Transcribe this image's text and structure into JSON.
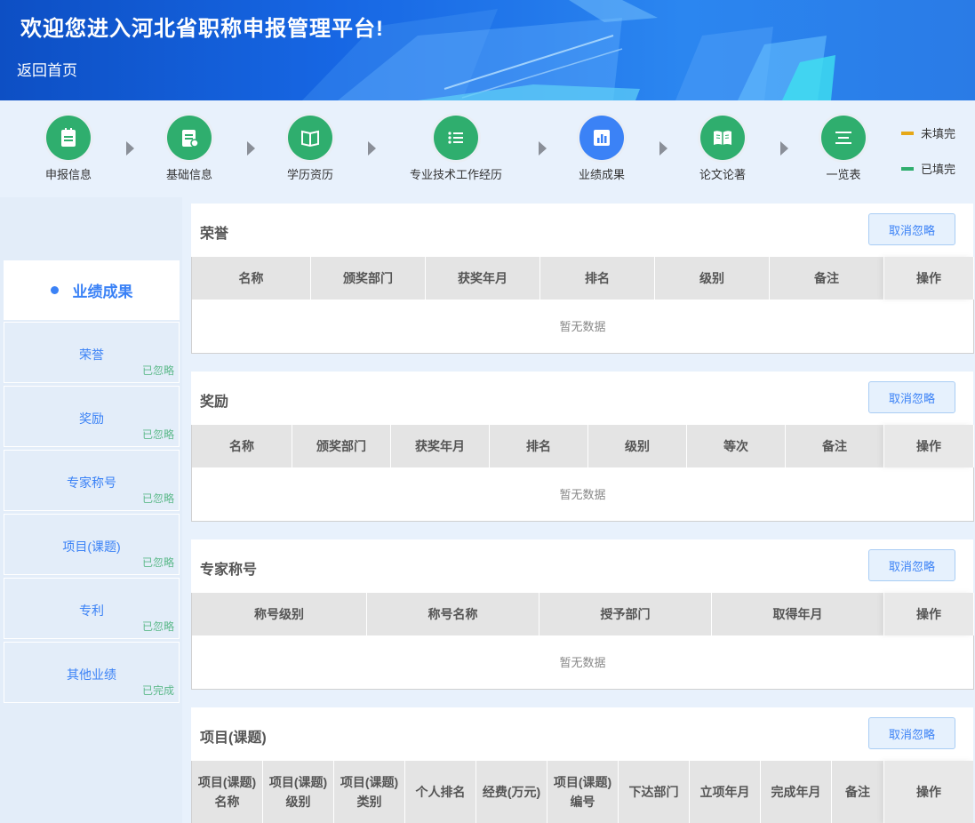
{
  "header": {
    "title": "欢迎您进入河北省职称申报管理平台!",
    "back_label": "返回首页"
  },
  "steps": [
    {
      "label": "申报信息",
      "icon": "clipboard-icon",
      "color": "green"
    },
    {
      "label": "基础信息",
      "icon": "edit-document-icon",
      "color": "green"
    },
    {
      "label": "学历资历",
      "icon": "book-icon",
      "color": "green"
    },
    {
      "label": "专业技术工作经历",
      "icon": "list-icon",
      "color": "green"
    },
    {
      "label": "业绩成果",
      "icon": "bar-chart-icon",
      "color": "blue"
    },
    {
      "label": "论文论著",
      "icon": "open-book-icon",
      "color": "green"
    },
    {
      "label": "一览表",
      "icon": "menu-icon",
      "color": "green"
    }
  ],
  "legend": {
    "incomplete": "未填完",
    "complete": "已填完",
    "incomplete_color": "#e6a817",
    "complete_color": "#2fae6e"
  },
  "sidebar": {
    "header": "业绩成果",
    "items": [
      {
        "name": "荣誉",
        "status": "已忽略"
      },
      {
        "name": "奖励",
        "status": "已忽略"
      },
      {
        "name": "专家称号",
        "status": "已忽略"
      },
      {
        "name": "项目(课题)",
        "status": "已忽略"
      },
      {
        "name": "专利",
        "status": "已忽略"
      },
      {
        "name": "其他业绩",
        "status": "已完成"
      }
    ]
  },
  "sections": {
    "honor": {
      "title": "荣誉",
      "button": "取消忽略",
      "columns": [
        "名称",
        "颁奖部门",
        "获奖年月",
        "排名",
        "级别",
        "备注",
        "操作"
      ],
      "empty": "暂无数据"
    },
    "award": {
      "title": "奖励",
      "button": "取消忽略",
      "columns": [
        "名称",
        "颁奖部门",
        "获奖年月",
        "排名",
        "级别",
        "等次",
        "备注",
        "操作"
      ],
      "empty": "暂无数据"
    },
    "expert": {
      "title": "专家称号",
      "button": "取消忽略",
      "columns": [
        "称号级别",
        "称号名称",
        "授予部门",
        "取得年月",
        "操作"
      ],
      "empty": "暂无数据"
    },
    "project": {
      "title": "项目(课题)",
      "button": "取消忽略",
      "columns": [
        "项目(课题)名称",
        "项目(课题)级别",
        "项目(课题)类别",
        "个人排名",
        "经费(万元)",
        "项目(课题)编号",
        "下达部门",
        "立项年月",
        "完成年月",
        "备注",
        "操作"
      ]
    }
  }
}
